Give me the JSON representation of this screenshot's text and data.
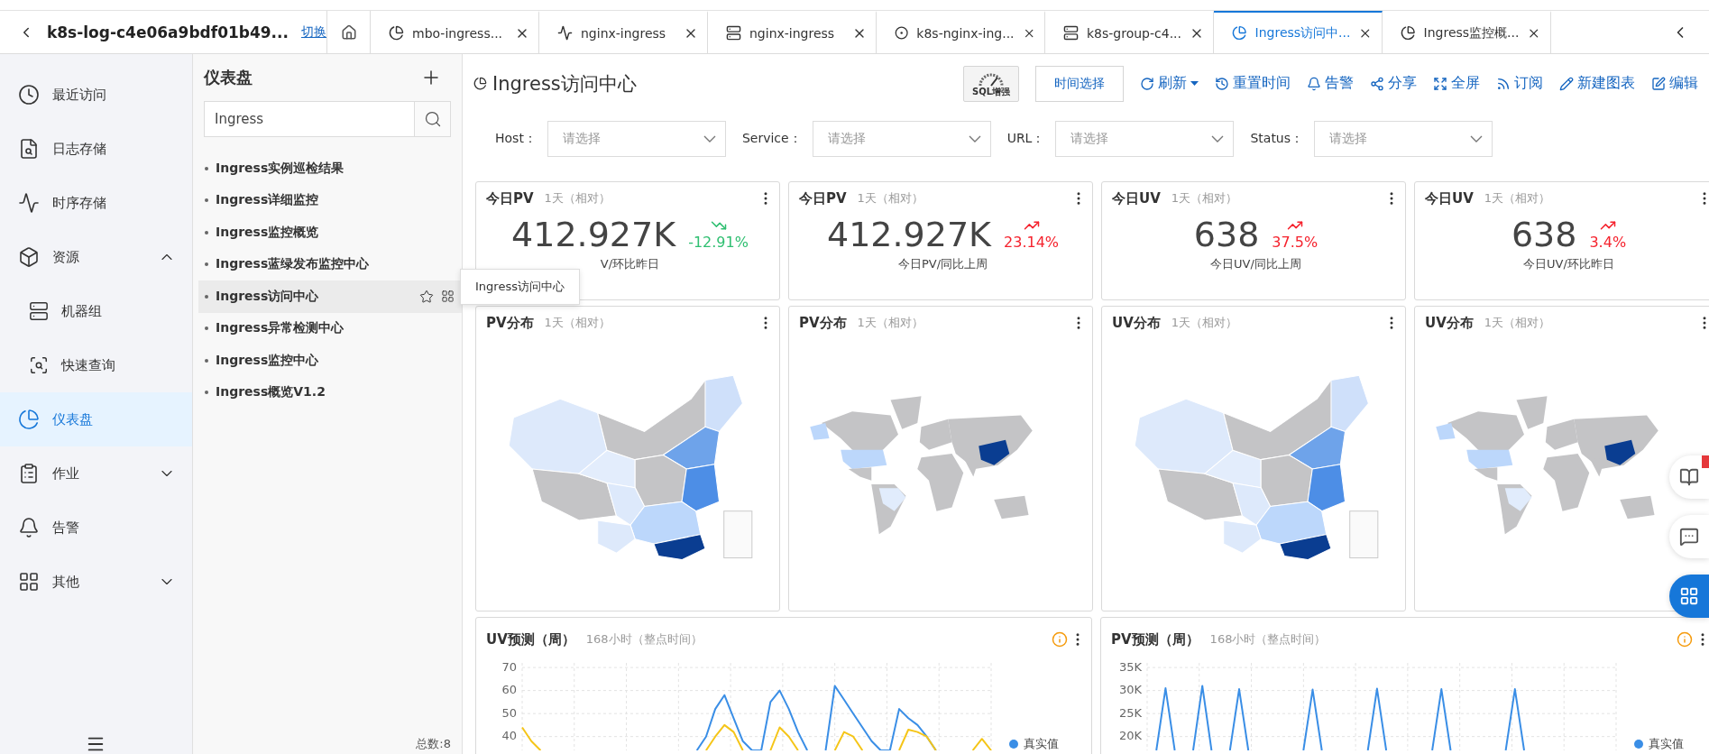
{
  "workspace": {
    "title": "k8s-log-c4e06a9bdf01b49...",
    "switch_link": "切换"
  },
  "tabs": [
    {
      "label": "mbo-ingress...",
      "selected": false
    },
    {
      "label": "nginx-ingress",
      "selected": false
    },
    {
      "label": "nginx-ingress",
      "selected": false
    },
    {
      "label": "k8s-nginx-ing...",
      "selected": false
    },
    {
      "label": "k8s-group-c4...",
      "selected": false
    },
    {
      "label": "Ingress访问中...",
      "selected": true
    },
    {
      "label": "Ingress监控概...",
      "selected": false
    }
  ],
  "nav": {
    "items": [
      {
        "label": "最近访问",
        "selected": false
      },
      {
        "label": "日志存储",
        "selected": false
      },
      {
        "label": "时序存储",
        "selected": false
      },
      {
        "label": "资源",
        "selected": false,
        "expanded": true,
        "children": [
          {
            "label": "机器组",
            "selected": false
          },
          {
            "label": "快速查询",
            "selected": false
          }
        ]
      },
      {
        "label": "仪表盘",
        "selected": true
      },
      {
        "label": "作业",
        "selected": false,
        "expanded": false
      },
      {
        "label": "告警",
        "selected": false
      },
      {
        "label": "其他",
        "selected": false,
        "expanded": false
      }
    ]
  },
  "dashboards": {
    "title": "仪表盘",
    "search": {
      "value": "Ingress"
    },
    "items": [
      {
        "label": "Ingress实例巡检结果",
        "selected": false
      },
      {
        "label": "Ingress详细监控",
        "selected": false
      },
      {
        "label": "Ingress监控概览",
        "selected": false
      },
      {
        "label": "Ingress蓝绿发布监控中心",
        "selected": false
      },
      {
        "label": "Ingress访问中心",
        "selected": true
      },
      {
        "label": "Ingress异常检测中心",
        "selected": false
      },
      {
        "label": "Ingress监控中心",
        "selected": false
      },
      {
        "label": "Ingress概览V1.2",
        "selected": false
      }
    ],
    "total": "总数:8"
  },
  "tooltip": "Ingress访问中心",
  "page": {
    "title": "Ingress访问中心",
    "sql_badge": "SQL增强",
    "time_button": "时间选择",
    "actions": [
      {
        "label": "刷新",
        "kind": "dropdown"
      },
      {
        "label": "重置时间",
        "kind": "link"
      },
      {
        "label": "告警",
        "kind": "link"
      },
      {
        "label": "分享",
        "kind": "link"
      },
      {
        "label": "全屏",
        "kind": "link"
      },
      {
        "label": "订阅",
        "kind": "link"
      },
      {
        "label": "新建图表",
        "kind": "link"
      },
      {
        "label": "编辑",
        "kind": "link"
      }
    ]
  },
  "filters": [
    {
      "label": "Host：",
      "placeholder": "请选择"
    },
    {
      "label": "Service：",
      "placeholder": "请选择"
    },
    {
      "label": "URL：",
      "placeholder": "请选择"
    },
    {
      "label": "Status：",
      "placeholder": "请选择"
    }
  ],
  "stats": [
    {
      "title": "今日PV",
      "range": "1天（相对）",
      "value": "412.927K",
      "change": "-12.91%",
      "kind": "down",
      "caption": "V/环比昨日"
    },
    {
      "title": "今日PV",
      "range": "1天（相对）",
      "value": "412.927K",
      "change": "23.14%",
      "kind": "up",
      "caption": "今日PV/同比上周"
    },
    {
      "title": "今日UV",
      "range": "1天（相对）",
      "value": "638",
      "change": "37.5%",
      "kind": "up",
      "caption": "今日UV/同比上周"
    },
    {
      "title": "今日UV",
      "range": "1天（相对）",
      "value": "638",
      "change": "3.4%",
      "kind": "up",
      "caption": "今日UV/环比昨日"
    }
  ],
  "maps": [
    {
      "title": "PV分布",
      "range": "1天（相对）",
      "kind": "china"
    },
    {
      "title": "PV分布",
      "range": "1天（相对）",
      "kind": "world"
    },
    {
      "title": "UV分布",
      "range": "1天（相对）",
      "kind": "china"
    },
    {
      "title": "UV分布",
      "range": "1天（相对）",
      "kind": "world"
    }
  ],
  "forecasts": [
    {
      "title": "UV预测（周）",
      "range": "168小时（整点时间）",
      "axis_labels": [
        "70",
        "60",
        "50",
        "40"
      ],
      "legend": "真实值"
    },
    {
      "title": "PV预测（周）",
      "range": "168小时（整点时间）",
      "axis_labels": [
        "35K",
        "30K",
        "25K",
        "20K"
      ],
      "legend": "真实值"
    }
  ]
}
